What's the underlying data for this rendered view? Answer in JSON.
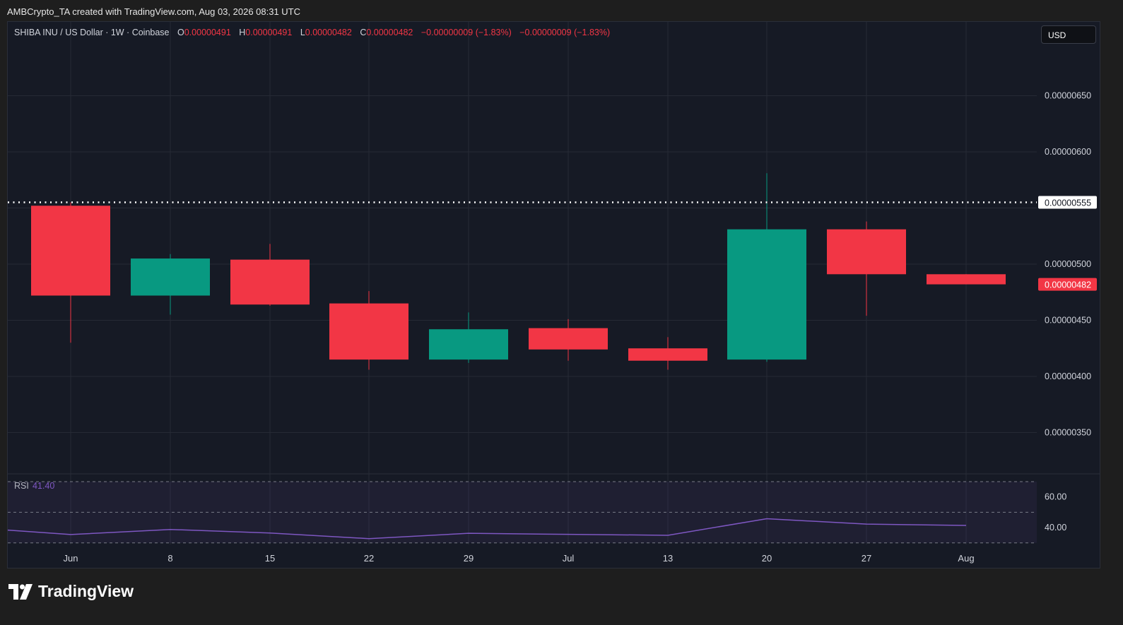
{
  "header": {
    "credit": "AMBCrypto_TA created with TradingView.com, Aug 03, 2026 08:31 UTC"
  },
  "legend": {
    "symbol": "SHIBA INU / US Dollar · 1W · Coinbase",
    "o_label": "O",
    "o_value": "0.00000491",
    "h_label": "H",
    "h_value": "0.00000491",
    "l_label": "L",
    "l_value": "0.00000482",
    "c_label": "C",
    "c_value": "0.00000482",
    "change": "−0.00000009 (−1.83%)",
    "change2": "−0.00000009 (−1.83%)"
  },
  "currency_button": "USD",
  "brand": {
    "name": "TradingView"
  },
  "colors": {
    "up": "#089981",
    "down": "#f23645",
    "rsi_line": "#7e57c2",
    "rsi_band": "#7e57c2",
    "grid": "#262a35",
    "axis_text": "#d1d4dc"
  },
  "chart_data": [
    {
      "type": "candlestick",
      "title": "",
      "x_ticks": [
        "Jun",
        "8",
        "15",
        "22",
        "29",
        "Jul",
        "13",
        "20",
        "27",
        "Aug"
      ],
      "y_ticks": [
        "0.00000350",
        "0.00000400",
        "0.00000450",
        "0.00000500",
        "0.00000600",
        "0.00000650"
      ],
      "ylim": [
        3.15e-06,
        7.02e-06
      ],
      "grid": true,
      "dotted_level": {
        "value": 5.55e-06,
        "label": "0.00000555"
      },
      "last_price": {
        "value": 4.82e-06,
        "label": "0.00000482"
      },
      "candles": [
        {
          "x": "Jun",
          "open": 5.52e-06,
          "high": 5.55e-06,
          "low": 4.3e-06,
          "close": 4.72e-06
        },
        {
          "x": "8",
          "open": 4.72e-06,
          "high": 5.09e-06,
          "low": 4.55e-06,
          "close": 5.05e-06
        },
        {
          "x": "15",
          "open": 5.04e-06,
          "high": 5.18e-06,
          "low": 4.63e-06,
          "close": 4.64e-06
        },
        {
          "x": "22",
          "open": 4.65e-06,
          "high": 4.76e-06,
          "low": 4.06e-06,
          "close": 4.15e-06
        },
        {
          "x": "29",
          "open": 4.15e-06,
          "high": 4.57e-06,
          "low": 4.12e-06,
          "close": 4.42e-06
        },
        {
          "x": "Jul",
          "open": 4.43e-06,
          "high": 4.51e-06,
          "low": 4.14e-06,
          "close": 4.24e-06
        },
        {
          "x": "13",
          "open": 4.25e-06,
          "high": 4.35e-06,
          "low": 4.06e-06,
          "close": 4.14e-06
        },
        {
          "x": "20",
          "open": 4.15e-06,
          "high": 5.81e-06,
          "low": 4.13e-06,
          "close": 5.31e-06
        },
        {
          "x": "27",
          "open": 5.31e-06,
          "high": 5.38e-06,
          "low": 4.54e-06,
          "close": 4.91e-06
        },
        {
          "x": "Aug",
          "open": 4.91e-06,
          "high": 4.91e-06,
          "low": 4.82e-06,
          "close": 4.82e-06
        }
      ]
    },
    {
      "type": "line",
      "name_label": "RSI",
      "value_label": "41.40",
      "y_ticks": [
        "60.00",
        "40.00"
      ],
      "ylim": [
        20,
        78
      ],
      "band": [
        30,
        70
      ],
      "mid": 50,
      "points": [
        {
          "x": "start",
          "y": 38.4
        },
        {
          "x": "Jun",
          "y": 35.5
        },
        {
          "x": "8",
          "y": 38.8
        },
        {
          "x": "15",
          "y": 36.5
        },
        {
          "x": "22",
          "y": 32.8
        },
        {
          "x": "29",
          "y": 36.3
        },
        {
          "x": "Jul",
          "y": 35.6
        },
        {
          "x": "13",
          "y": 35.0
        },
        {
          "x": "20",
          "y": 45.8
        },
        {
          "x": "27",
          "y": 42.3
        },
        {
          "x": "Aug",
          "y": 41.4
        }
      ]
    }
  ]
}
